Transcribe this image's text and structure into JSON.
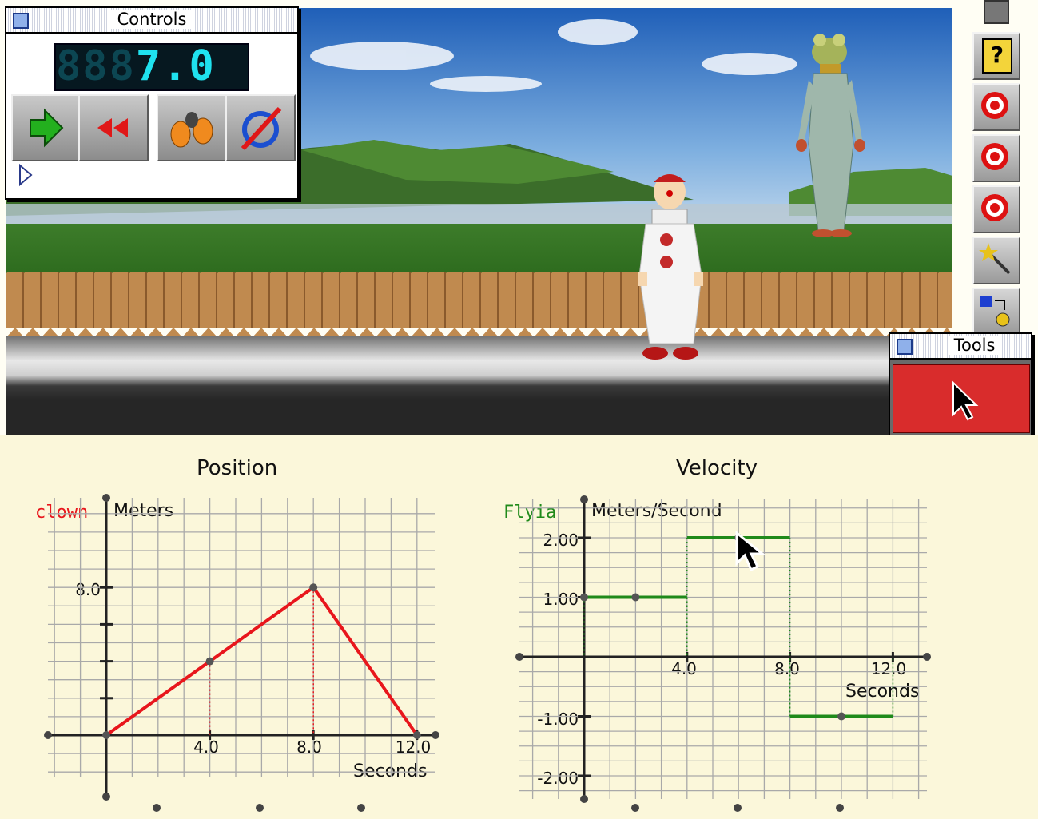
{
  "controls": {
    "title": "Controls",
    "lcd_dim": "888",
    "lcd_value": "7.0",
    "buttons": [
      {
        "name": "play-button",
        "icon": "green-arrow-right-icon"
      },
      {
        "name": "rewind-button",
        "icon": "red-double-arrow-left-icon"
      },
      {
        "name": "step-button",
        "icon": "footprints-icon"
      },
      {
        "name": "reset-button",
        "icon": "circular-arrow-slash-icon"
      }
    ]
  },
  "tools": {
    "title": "Tools",
    "cells": [
      "arrow-pointer-icon",
      "footprint-track-icon",
      "lasso-duplicate-icon",
      "tape-measure-icon",
      "ruler-weight-icon",
      "pencil-eraser-icon",
      "no-trail-icon"
    ]
  },
  "colors": {
    "clown": "#e8161c",
    "flyia": "#1f8a1a",
    "toolbar_red": "#d92c2c",
    "grid": "#a9a9a9"
  },
  "position_graph": {
    "title": "Position",
    "series_label": "clown",
    "y_label": "Meters",
    "x_label": "Seconds",
    "x_ticks": [
      "4.0",
      "8.0",
      "12.0"
    ],
    "y_ticks": [
      "8.0"
    ]
  },
  "velocity_graph": {
    "title": "Velocity",
    "series_label": "Flyia",
    "y_label": "Meters/Second",
    "x_label": "Seconds",
    "x_ticks": [
      "4.0",
      "8.0",
      "12.0"
    ],
    "y_ticks": [
      "2.00",
      "1.00",
      "-1.00",
      "-2.00"
    ]
  },
  "chart_data": [
    {
      "type": "line",
      "title": "Position",
      "ylabel": "Meters",
      "xlabel": "Seconds",
      "series": [
        {
          "name": "clown",
          "x": [
            0,
            4,
            8,
            12
          ],
          "y": [
            0,
            4,
            8,
            0
          ]
        }
      ],
      "xlim": [
        -2,
        13
      ],
      "ylim": [
        -2.5,
        9.5
      ],
      "grid": true
    },
    {
      "type": "line",
      "title": "Velocity",
      "ylabel": "Meters/Second",
      "xlabel": "Seconds",
      "series": [
        {
          "name": "Flyia",
          "segments": [
            {
              "x": [
                0,
                4
              ],
              "y": [
                1,
                1
              ]
            },
            {
              "x": [
                4,
                8
              ],
              "y": [
                2,
                2
              ]
            },
            {
              "x": [
                8,
                12
              ],
              "y": [
                -1,
                -1
              ]
            }
          ],
          "points": [
            [
              0,
              1
            ],
            [
              2,
              1
            ],
            [
              6,
              2
            ],
            [
              10,
              -1
            ]
          ]
        }
      ],
      "xlim": [
        -2.5,
        13.5
      ],
      "ylim": [
        -2.3,
        2.6
      ],
      "grid": true
    }
  ],
  "strip": {
    "buttons": [
      "help-icon",
      "target-icon",
      "target-icon",
      "target-icon",
      "magic-wand-icon",
      "swap-shapes-icon"
    ]
  }
}
